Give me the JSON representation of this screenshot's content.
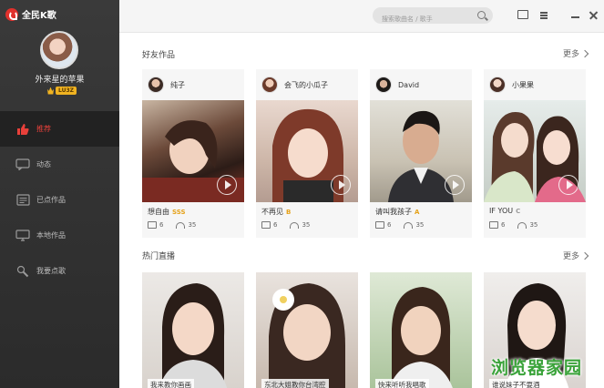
{
  "app": {
    "logo_text": "全民K歌"
  },
  "user": {
    "name": "外来星的苹果",
    "level": "LU3Z"
  },
  "nav": {
    "items": [
      {
        "label": "推荐",
        "icon": "thumbs-up-icon",
        "active": true
      },
      {
        "label": "动态",
        "icon": "chat-icon",
        "active": false
      },
      {
        "label": "已点作品",
        "icon": "songlist-icon",
        "active": false
      },
      {
        "label": "本地作品",
        "icon": "monitor-icon",
        "active": false
      },
      {
        "label": "我要点歌",
        "icon": "microphone-icon",
        "active": false
      }
    ]
  },
  "search": {
    "placeholder": "搜索歌曲名 / 歌手"
  },
  "friends_section": {
    "title": "好友作品",
    "more": "更多",
    "cards": [
      {
        "user": "纯子",
        "song": "想自由",
        "score": "SSS",
        "score_color": "#e5a21a",
        "comments": "6",
        "listens": "35"
      },
      {
        "user": "会飞的小瓜子",
        "song": "不再见",
        "score": "B",
        "score_color": "#e5a21a",
        "comments": "6",
        "listens": "35"
      },
      {
        "user": "David",
        "song": "请叫我孩子",
        "score": "A",
        "score_color": "#e5a21a",
        "comments": "6",
        "listens": "35"
      },
      {
        "user": "小果果",
        "song": "IF YOU",
        "score": "C",
        "score_color": "#9a9a9a",
        "comments": "6",
        "listens": "35"
      }
    ]
  },
  "live_section": {
    "title": "热门直播",
    "more": "更多",
    "cards": [
      {
        "caption": "我来教你画画"
      },
      {
        "caption": "东北大姐教你台湾腔"
      },
      {
        "caption": "快来听听我唱歌"
      },
      {
        "caption": "谁说妹子不耍酒"
      }
    ]
  },
  "watermark": "浏览器家园",
  "colors": {
    "accent": "#e8403a",
    "sidebar_bg": "#333333",
    "score_gold": "#e5a21a"
  }
}
